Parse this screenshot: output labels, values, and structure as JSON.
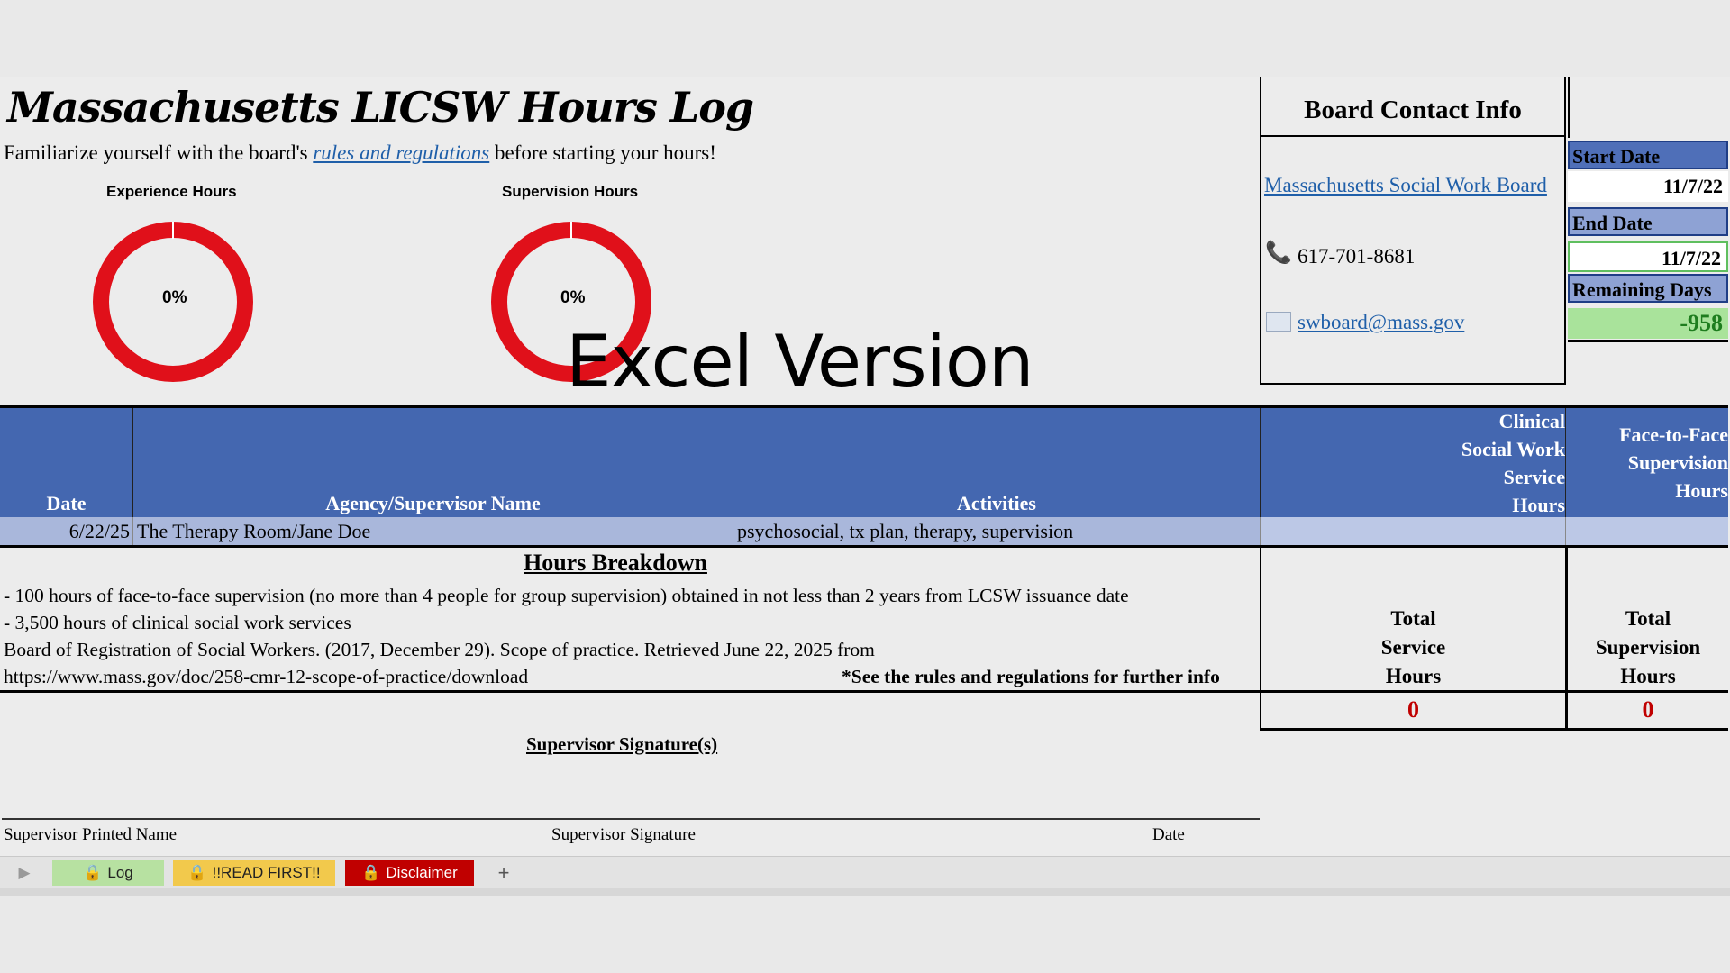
{
  "header": {
    "title": "Massachusetts LICSW Hours Log",
    "subtitle_before": "Familiarize yourself with the board's ",
    "subtitle_link": "rules and regulations",
    "subtitle_after": " before starting your hours!"
  },
  "gauges": [
    {
      "title": "Experience Hours",
      "percent_label": "0%",
      "progress": 0,
      "color": "#e0101a"
    },
    {
      "title": "Supervision Hours",
      "percent_label": "0%",
      "progress": 0,
      "color": "#e0101a"
    }
  ],
  "overlay_text": "Excel Version",
  "contact": {
    "title": "Board Contact Info",
    "board_link": "Massachusetts Social Work Board",
    "phone": "617-701-8681",
    "email": "swboard@mass.gov"
  },
  "dates": {
    "start_label": "Start Date",
    "start_value": "11/7/22",
    "end_label": "End Date",
    "end_value": "11/7/22",
    "remaining_label": "Remaining Days",
    "remaining_value": "-958"
  },
  "table": {
    "headers": {
      "date": "Date",
      "agency": "Agency/Supervisor Name",
      "activities": "Activities",
      "clinical": [
        "Clinical",
        "Social Work",
        "Service",
        "Hours"
      ],
      "face": [
        "Face-to-Face",
        "Supervision",
        "Hours"
      ]
    },
    "rows": [
      {
        "date": "6/22/25",
        "agency": "The Therapy Room/Jane Doe",
        "activities": "psychosocial, tx plan, therapy, supervision",
        "clinical": "",
        "face": ""
      }
    ]
  },
  "breakdown": {
    "title": "Hours Breakdown",
    "line1": "- 100 hours of face-to-face supervision (no more than 4 people for group supervision) obtained in not less than 2 years from LCSW issuance date",
    "line2": "- 3,500 hours of clinical social work services",
    "line3": "Board of Registration of Social Workers. (2017, December 29). Scope of practice. Retrieved June 22, 2025 from",
    "line4": "https://www.mass.gov/doc/258-cmr-12-scope-of-practice/download",
    "note": "*See the rules and regulations for further info"
  },
  "totals": {
    "service_label": [
      "Total",
      "Service",
      "Hours"
    ],
    "supervision_label": [
      "Total",
      "Supervision",
      "Hours"
    ],
    "service_value": "0",
    "supervision_value": "0"
  },
  "signature": {
    "title": "Supervisor Signature(s)",
    "printed_name": "Supervisor Printed Name",
    "signature": "Supervisor Signature",
    "date": "Date"
  },
  "tabs": [
    {
      "label": "Log",
      "icon": "lock-icon",
      "bg": "#b7e1a1"
    },
    {
      "label": "!!READ FIRST!!",
      "icon": "lock-icon",
      "bg": "#f2c94c"
    },
    {
      "label": "Disclaimer",
      "icon": "lock-icon",
      "bg": "#c00000"
    }
  ],
  "add_tab_label": "+"
}
